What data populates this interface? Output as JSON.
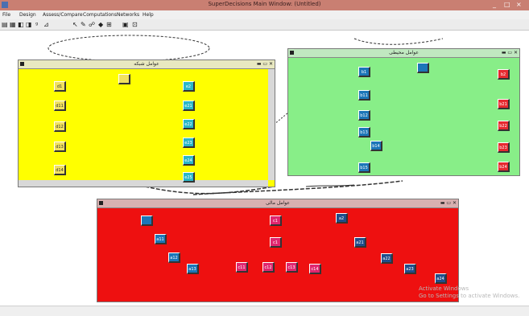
{
  "window": {
    "title": "SuperDecisions Main Window: (Untitled)",
    "buttons": [
      "_",
      "□",
      "×"
    ]
  },
  "menu": {
    "items": [
      "File",
      "Design",
      "Assess/Compare",
      "Computations",
      "Networks",
      "Help"
    ]
  },
  "toolbar": {
    "icons": [
      "open-icon",
      "save-icon",
      "ahp-icon",
      "anp-icon",
      "arrow-icon",
      "node-icon",
      "cluster-icon",
      "link-icon",
      "compare-icon",
      "calc-icon"
    ],
    "glyphs": [
      "▤",
      "▦",
      "◧",
      "◨",
      "ᵍ",
      "⊿",
      "↖",
      "✎",
      "☍",
      "◆",
      "⊞",
      "▣",
      "⊡"
    ]
  },
  "clusters": [
    {
      "id": "yellow",
      "title": "عوامل شبکه",
      "color": "#ffff00",
      "nodes": [
        {
          "label": "",
          "color": "yel"
        },
        {
          "label": "d1",
          "color": "yel"
        },
        {
          "label": "d11",
          "color": "yel"
        },
        {
          "label": "d12",
          "color": "yel"
        },
        {
          "label": "d13",
          "color": "yel"
        },
        {
          "label": "d14",
          "color": "yel"
        },
        {
          "label": "e2",
          "color": "cyan"
        },
        {
          "label": "e21",
          "color": "cyan"
        },
        {
          "label": "e22",
          "color": "cyan"
        },
        {
          "label": "e23",
          "color": "cyan"
        },
        {
          "label": "e24",
          "color": "cyan"
        },
        {
          "label": "e25",
          "color": "cyan"
        }
      ]
    },
    {
      "id": "green",
      "title": "عوامل محیطی",
      "color": "#88ee88",
      "nodes": [
        {
          "label": "b1",
          "color": "blue"
        },
        {
          "label": "",
          "color": "blue"
        },
        {
          "label": "b11",
          "color": "blue"
        },
        {
          "label": "b12",
          "color": "blue"
        },
        {
          "label": "b13",
          "color": "blue"
        },
        {
          "label": "b14",
          "color": "blue"
        },
        {
          "label": "b15",
          "color": "blue"
        },
        {
          "label": "b2",
          "color": "red"
        },
        {
          "label": "b21",
          "color": "red"
        },
        {
          "label": "b22",
          "color": "red"
        },
        {
          "label": "b23",
          "color": "red"
        },
        {
          "label": "b24",
          "color": "red"
        }
      ]
    },
    {
      "id": "red",
      "title": "عوامل مالی",
      "color": "#ee1010",
      "nodes": [
        {
          "label": "",
          "color": "blue"
        },
        {
          "label": "a11",
          "color": "blue"
        },
        {
          "label": "a12",
          "color": "blue"
        },
        {
          "label": "a13",
          "color": "blue"
        },
        {
          "label": "c1",
          "color": "pink"
        },
        {
          "label": "c1",
          "color": "pink"
        },
        {
          "label": "c11",
          "color": "pink"
        },
        {
          "label": "c12",
          "color": "pink"
        },
        {
          "label": "c13",
          "color": "pink"
        },
        {
          "label": "c14",
          "color": "pink"
        },
        {
          "label": "a2",
          "color": "navy"
        },
        {
          "label": "a21",
          "color": "navy"
        },
        {
          "label": "a22",
          "color": "navy"
        },
        {
          "label": "a23",
          "color": "navy"
        },
        {
          "label": "a24",
          "color": "navy"
        }
      ]
    }
  ],
  "watermark": {
    "line1": "Activate Windows",
    "line2": "Go to Settings to activate Windows."
  }
}
